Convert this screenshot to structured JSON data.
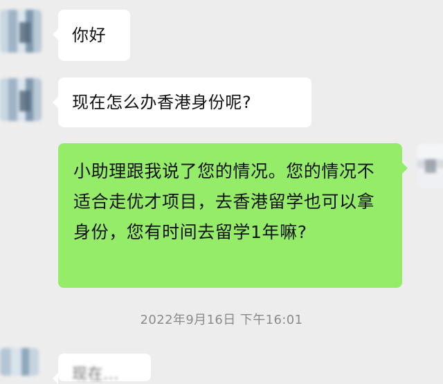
{
  "chat": {
    "messages": [
      {
        "sender": "contact",
        "text": "你好"
      },
      {
        "sender": "contact",
        "text": "现在怎么办香港身份呢?"
      },
      {
        "sender": "self",
        "text": "小助理跟我说了您的情况。您的情况不适合走优才项目，去香港留学也可以拿身份，您有时间去留学1年嘛?"
      }
    ],
    "timestamp": "2022年9月16日 下午16:01",
    "partial_message": "现在..."
  },
  "colors": {
    "background": "#ededed",
    "incoming_bubble": "#ffffff",
    "outgoing_bubble": "#95ec69",
    "timestamp_text": "#8a8a8a"
  },
  "icons": {
    "contact_avatar": "blurred-contact-avatar",
    "self_avatar": "blurred-self-avatar"
  }
}
